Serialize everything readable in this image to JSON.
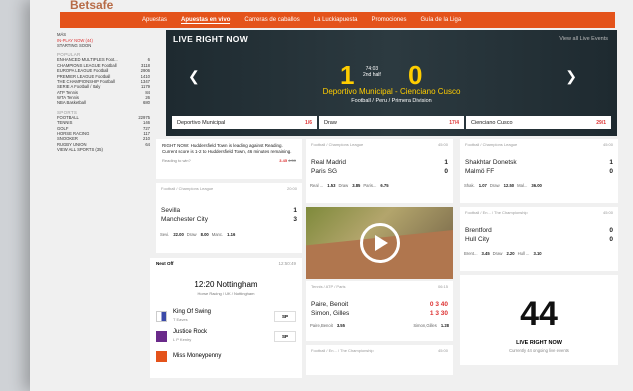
{
  "nav": {
    "logo": "Betsafe",
    "items": [
      "Apuestas",
      "Apuestas en vivo",
      "Carreras de caballos",
      "La Luckiapuesta",
      "Promociones",
      "Guía de la Liga"
    ],
    "active_index": 1
  },
  "sidebar": {
    "top": [
      {
        "label": "MÁS",
        "count": ""
      },
      {
        "label": "IN-PLAY NOW (44)",
        "count": ""
      },
      {
        "label": "STARTING SOON",
        "count": ""
      }
    ],
    "popular_header": "POPULAR",
    "popular": [
      {
        "label": "ENHANCED MULTIPLES Foot...",
        "count": "6"
      },
      {
        "label": "CHAMPIONS LEAGUE Football",
        "count": "3118"
      },
      {
        "label": "EUROPA LEAGUE Football",
        "count": "2906"
      },
      {
        "label": "PREMIER LEAGUE Football",
        "count": "1410"
      },
      {
        "label": "THE CHAMPIONSHIP Football",
        "count": "1347"
      },
      {
        "label": "SERIE A Football / Italy",
        "count": "1179"
      },
      {
        "label": "ATP Tennis",
        "count": "84"
      },
      {
        "label": "WTA Tennis",
        "count": "26"
      },
      {
        "label": "NBA Basketball",
        "count": "680"
      }
    ],
    "sports_header": "SPORTS",
    "sports": [
      {
        "label": "FOOTBALL",
        "count": "22975"
      },
      {
        "label": "TENNIS",
        "count": "146"
      },
      {
        "label": "GOLF",
        "count": "727"
      },
      {
        "label": "HORSE RACING",
        "count": "117"
      },
      {
        "label": "SNOOKER",
        "count": "210"
      },
      {
        "label": "RUGBY UNION",
        "count": "64"
      }
    ],
    "view_all": "VIEW ALL SPORTS (35)"
  },
  "hero": {
    "title": "LIVE RIGHT NOW",
    "view_all": "View all Live Events",
    "home_score": "1",
    "away_score": "0",
    "clock": "74:03",
    "period": "2nd half",
    "match": "Deportivo Municipal - Cienciano Cusco",
    "league": "Football / Peru / Primera Division",
    "odds": [
      {
        "label": "Deportivo Municipal",
        "price": "1/6"
      },
      {
        "label": "Draw",
        "price": "17/4"
      },
      {
        "label": "Cienciano Cusco",
        "price": "29/1"
      }
    ]
  },
  "news": {
    "text": "RIGHT NOW: Huddersfield Town is leading against Reading. Current score is 1-2 to Huddersfield Town, 46 minutes remaining.",
    "bet_label": "Reading to win?",
    "price": "3.45",
    "old_price": "4.50"
  },
  "match1": {
    "header": "Football / Champions League",
    "time": "20:00",
    "home": "Sevilla",
    "home_score": "1",
    "away": "Manchester City",
    "away_score": "3",
    "odds": [
      {
        "l": "Sevi.",
        "v": "22.00"
      },
      {
        "l": "Draw",
        "v": "8.00"
      },
      {
        "l": "Manc.",
        "v": "1.16"
      }
    ]
  },
  "match2": {
    "header": "Football / Champions League",
    "time": "45:00",
    "home": "Real Madrid",
    "home_score": "1",
    "away": "Paris SG",
    "away_score": "0",
    "odds": [
      {
        "l": "Real ...",
        "v": "1.53"
      },
      {
        "l": "Draw",
        "v": "3.85"
      },
      {
        "l": "Paris...",
        "v": "6.75"
      }
    ]
  },
  "match3": {
    "header": "Football / Champions League",
    "time": "45:00",
    "home": "Shakhtar Donetsk",
    "home_score": "1",
    "away": "Malmö FF",
    "away_score": "0",
    "odds": [
      {
        "l": "Shak.",
        "v": "1.07"
      },
      {
        "l": "Draw",
        "v": "12.50"
      },
      {
        "l": "Mal...",
        "v": "36.00"
      }
    ]
  },
  "match4": {
    "header": "Football / En... / The Championship",
    "time": "45:00",
    "home": "Brentford",
    "home_score": "0",
    "away": "Hull City",
    "away_score": "0",
    "odds": [
      {
        "l": "Brent...",
        "v": "3.45"
      },
      {
        "l": "Draw",
        "v": "2.20"
      },
      {
        "l": "Hull ...",
        "v": "3.10"
      }
    ]
  },
  "tennis": {
    "header": "Tennis / ATP / Paris",
    "time": "06:15",
    "p1": "Paire, Benoit",
    "p1_score": "0 3 40",
    "p2": "Simon, Gilles",
    "p2_score": "1 3 30",
    "odds": [
      {
        "l": "Paire,Benoit",
        "v": "3.55"
      },
      {
        "l": "Simon,Gilles",
        "v": "1.28"
      }
    ]
  },
  "match5": {
    "header": "Football / En... / The Championship",
    "time": "45:00"
  },
  "race": {
    "next_off": "Next Off",
    "clock": "12:50:49",
    "time": "12:20 Nottingham",
    "sub": "Horse Racing / UK / Nottingham",
    "runners": [
      {
        "name": "King Of Swing",
        "jockey": "T Eaves",
        "price": "SP"
      },
      {
        "name": "Justice Rock",
        "jockey": "L P Keniry",
        "price": "SP"
      },
      {
        "name": "Miss Moneypenny",
        "jockey": "",
        "price": ""
      }
    ]
  },
  "live_count": {
    "number": "44",
    "label": "LIVE RIGHT NOW",
    "sub": "Currently 44 ongoing live events"
  },
  "colors": {
    "brand": "#e4531b",
    "accent": "#ffcd00",
    "price": "#dd3333"
  }
}
